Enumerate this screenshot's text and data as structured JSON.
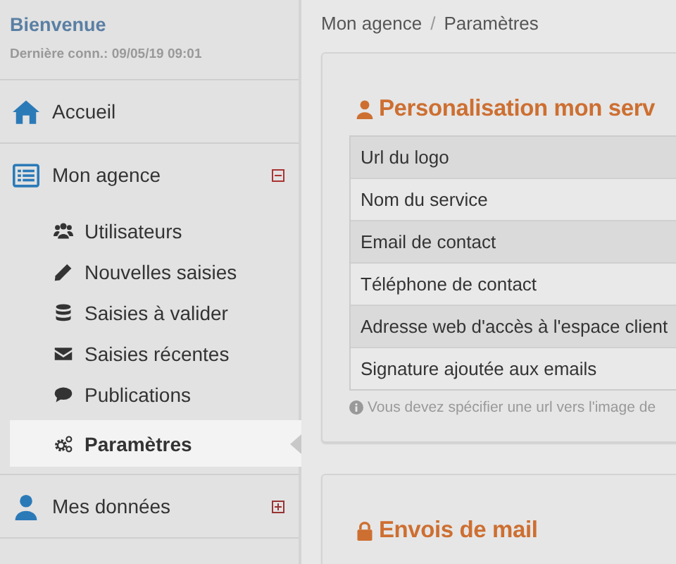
{
  "sidebar": {
    "greeting": "Bienvenue",
    "last_login": "Dernière conn.: 09/05/19 09:01",
    "items": [
      {
        "label": "Accueil"
      },
      {
        "label": "Mon agence",
        "expanded": true,
        "children": [
          {
            "label": "Utilisateurs",
            "selected": false
          },
          {
            "label": "Nouvelles saisies",
            "selected": false
          },
          {
            "label": "Saisies à valider",
            "selected": false
          },
          {
            "label": "Saisies récentes",
            "selected": false
          },
          {
            "label": "Publications",
            "selected": false
          },
          {
            "label": "Paramètres",
            "selected": true
          }
        ]
      },
      {
        "label": "Mes données",
        "expanded": false
      }
    ]
  },
  "breadcrumb": {
    "items": [
      "Mon agence",
      "Paramètres"
    ],
    "separator": "/"
  },
  "panels": [
    {
      "title": "Personalisation mon serv",
      "table": {
        "rows": [
          {
            "label": "Url du logo"
          },
          {
            "label": "Nom du service"
          },
          {
            "label": "Email de contact"
          },
          {
            "label": "Téléphone de contact"
          },
          {
            "label": "Adresse web d'accès à l'espace client"
          },
          {
            "label": "Signature ajoutée aux emails"
          }
        ]
      },
      "note": "Vous devez spécifier une url vers l'image de"
    },
    {
      "title": "Envois de mail"
    }
  ]
}
